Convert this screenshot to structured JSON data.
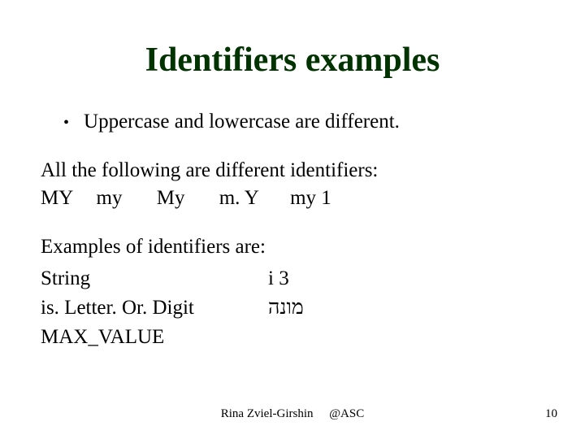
{
  "title": "Identifiers examples",
  "bullet": "Uppercase and lowercase are different.",
  "intro": "All the following are different identifiers:",
  "idents": {
    "a": "MY",
    "b": "my",
    "c": "My",
    "d": "m. Y",
    "e": "my 1"
  },
  "examples_heading": "Examples of identifiers are:",
  "examples": {
    "l1": "String",
    "r1": "i 3",
    "l2": "is. Letter. Or. Digit",
    "r2": "מונה",
    "l3": "MAX_VALUE"
  },
  "footer": {
    "author": "Rina Zviel-Girshin",
    "org": "@ASC",
    "page": "10"
  }
}
